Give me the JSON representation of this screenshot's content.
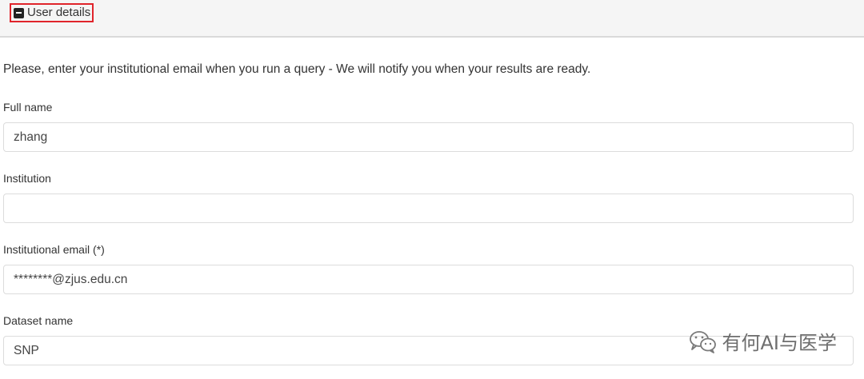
{
  "panel": {
    "toggle_icon": "minus-square-icon",
    "title": "User details"
  },
  "intro_text": "Please, enter your institutional email when you run a query - We will notify you when your results are ready.",
  "fields": {
    "full_name": {
      "label": "Full name",
      "value": "zhang"
    },
    "institution": {
      "label": "Institution",
      "value": ""
    },
    "email": {
      "label": "Institutional email (*)",
      "value": "********@zjus.edu.cn"
    },
    "dataset": {
      "label": "Dataset name",
      "value": "SNP"
    }
  },
  "watermark": {
    "icon": "wechat-icon",
    "text": "有何AI与医学"
  },
  "colors": {
    "highlight_border": "#e0242b",
    "header_bg": "#f5f5f5"
  }
}
